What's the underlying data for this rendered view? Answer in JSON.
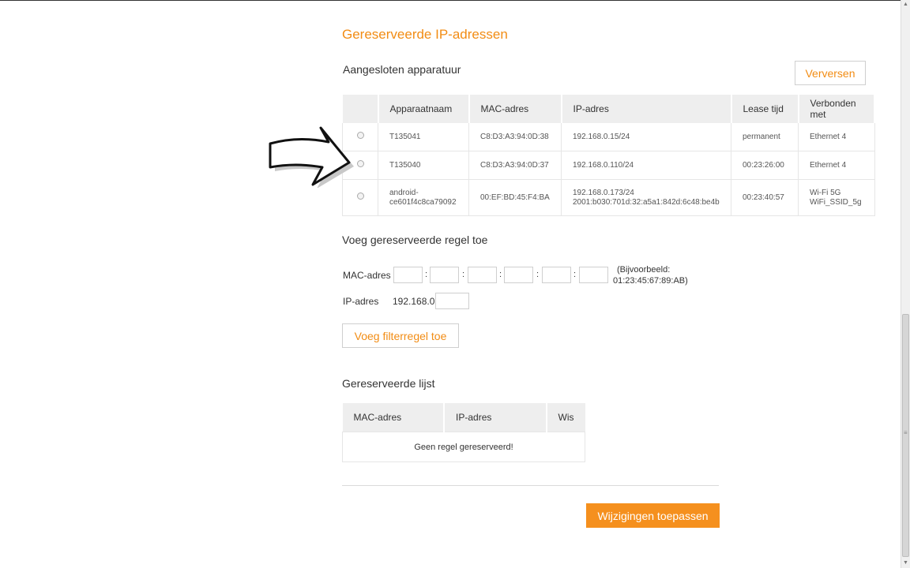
{
  "page": {
    "title": "Gereserveerde IP-adressen"
  },
  "devices": {
    "heading": "Aangesloten apparatuur",
    "refresh_label": "Verversen",
    "columns": [
      "",
      "Apparaatnaam",
      "MAC-adres",
      "IP-adres",
      "Lease tijd",
      "Verbonden met"
    ],
    "rows": [
      {
        "name_1": "T135041",
        "name_2": "",
        "mac": "C8:D3:A3:94:0D:38",
        "ip_1": "192.168.0.15/24",
        "ip_2": "",
        "lease": "permanent",
        "conn_1": "Ethernet 4",
        "conn_2": ""
      },
      {
        "name_1": "T135040",
        "name_2": "",
        "mac": "C8:D3:A3:94:0D:37",
        "ip_1": "192.168.0.110/24",
        "ip_2": "",
        "lease": "00:23:26:00",
        "conn_1": "Ethernet 4",
        "conn_2": ""
      },
      {
        "name_1": "android-",
        "name_2": "ce601f4c8ca79092",
        "mac": "00:EF:BD:45:F4:BA",
        "ip_1": "192.168.0.173/24",
        "ip_2": "2001:b030:701d:32:a5a1:842d:6c48:be4b",
        "lease": "00:23:40:57",
        "conn_1": "Wi-Fi 5G",
        "conn_2": "WiFi_SSID_5g"
      }
    ]
  },
  "add_rule": {
    "heading": "Voeg gereserveerde regel toe",
    "mac_label": "MAC-adres",
    "separator": ":",
    "example_1": "(Bijvoorbeeld:",
    "example_2": "01:23:45:67:89:AB)",
    "ip_label": "IP-adres",
    "ip_prefix": "192.168.0.",
    "add_button": "Voeg filterregel toe"
  },
  "reserved": {
    "heading": "Gereserveerde lijst",
    "columns": [
      "MAC-adres",
      "IP-adres",
      "Wis"
    ],
    "empty_text": "Geen regel gereserveerd!"
  },
  "apply_label": "Wijzigingen toepassen",
  "colors": {
    "accent": "#f28c14",
    "primary_button": "#f5901e",
    "table_header": "#eeeeee"
  }
}
